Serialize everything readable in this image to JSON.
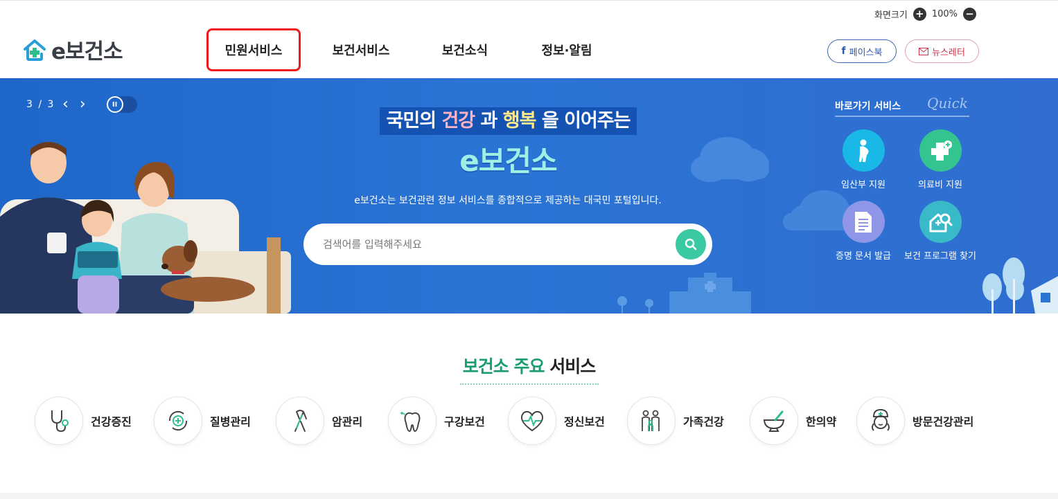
{
  "header": {
    "zoom_label": "화면크기",
    "zoom_value": "100%",
    "zoom_in": "+",
    "zoom_out": "−",
    "logo_text": "e보건소",
    "nav": [
      {
        "label": "민원서비스"
      },
      {
        "label": "보건서비스"
      },
      {
        "label": "보건소식"
      },
      {
        "label": "정보·알림"
      }
    ],
    "facebook_label": "페이스북",
    "newsletter_label": "뉴스레터"
  },
  "banner": {
    "slide_counter": "3 / 3",
    "hero_prefix": "국민의 ",
    "hero_health": "건강",
    "hero_mid": " 과 ",
    "hero_happy": "행복",
    "hero_suffix": " 을 이어주는",
    "hero_brand": "e보건소",
    "description": "e보건소는 보건관련 정보 서비스를 종합적으로 제공하는 대국민 포털입니다.",
    "search_placeholder": "검색어를 입력해주세요",
    "quick_title": "바로가기 서비스",
    "quick_script": "Quick",
    "quick_items": [
      {
        "label": "임산부 지원",
        "color": "#19b8e6"
      },
      {
        "label": "의료비 지원",
        "color": "#33c48f"
      },
      {
        "label": "증명 문서 발급",
        "color": "#8f96e8"
      },
      {
        "label": "보건 프로그램 찾기",
        "color": "#3ab9c8"
      }
    ]
  },
  "services": {
    "title_green": "보건소 주요",
    "title_rest": " 서비스",
    "items": [
      {
        "label": "건강증진",
        "icon": "stethoscope-icon"
      },
      {
        "label": "질병관리",
        "icon": "disease-care-icon"
      },
      {
        "label": "암관리",
        "icon": "ribbon-icon"
      },
      {
        "label": "구강보건",
        "icon": "tooth-icon"
      },
      {
        "label": "정신보건",
        "icon": "heart-pulse-icon"
      },
      {
        "label": "가족건강",
        "icon": "family-icon"
      },
      {
        "label": "한의약",
        "icon": "mortar-icon"
      },
      {
        "label": "방문건강관리",
        "icon": "nurse-icon"
      }
    ]
  },
  "colors": {
    "brand_blue": "#1f66c9",
    "accent_green": "#1a9c72",
    "search_button": "#3bc9a3",
    "highlight_red": "#ee1a1a"
  }
}
